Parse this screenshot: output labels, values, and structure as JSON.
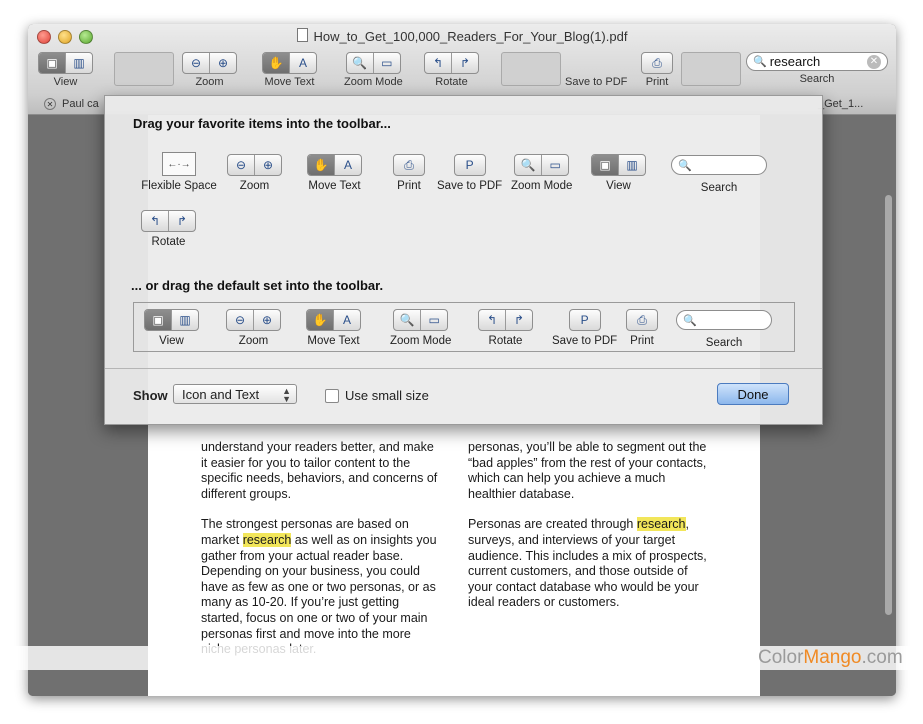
{
  "window": {
    "title": "How_to_Get_100,000_Readers_For_Your_Blog(1).pdf"
  },
  "toolbar": {
    "view_label": "View",
    "zoom_label": "Zoom",
    "move_text_label": "Move Text",
    "zoom_mode_label": "Zoom Mode",
    "rotate_label": "Rotate",
    "save_pdf_label": "Save to PDF",
    "print_label": "Print",
    "search_label": "Search",
    "search_value": "research"
  },
  "tabs": [
    {
      "label": "Paul ca"
    },
    {
      "label": "_Get_1..."
    }
  ],
  "document": {
    "col1": [
      "understand your readers better, and make it easier for you to tailor content to the specific needs, behaviors, and concerns of different groups.",
      {
        "before": "The strongest personas are based on market ",
        "hl": "research",
        "after": " as well as on insights you gather from your actual reader base. Depending on your business, you could have as few as one or two personas, or as many as 10-20. If you’re just getting started, focus on one or two of your main personas first and move into the more niche personas later."
      }
    ],
    "col2": [
      "personas, you’ll be able to segment out the “bad apples” from the rest of your contacts, which can help you achieve a much healthier database.",
      {
        "before": "Personas are created through ",
        "hl": "research",
        "after": ", surveys, and interviews of your target audience. This includes a mix of prospects, current customers, and those outside of your contact database who would be your ideal readers or customers."
      }
    ]
  },
  "sheet": {
    "heading_top": "Drag your favorite items into the toolbar...",
    "heading_default": "... or drag the default set into the toolbar.",
    "items": {
      "flexible_space": "Flexible Space",
      "zoom": "Zoom",
      "move_text": "Move Text",
      "print": "Print",
      "save_pdf": "Save to PDF",
      "zoom_mode": "Zoom Mode",
      "view": "View",
      "search": "Search",
      "rotate": "Rotate"
    },
    "show_label": "Show",
    "show_value": "Icon and Text",
    "small_size_label": "Use small size",
    "done_label": "Done"
  },
  "watermark": {
    "part1": "Color",
    "part2": "Mango",
    ".com": ".com"
  },
  "colors": {
    "highlight": "#f2e65a",
    "done_button": "#8cb7ec"
  }
}
